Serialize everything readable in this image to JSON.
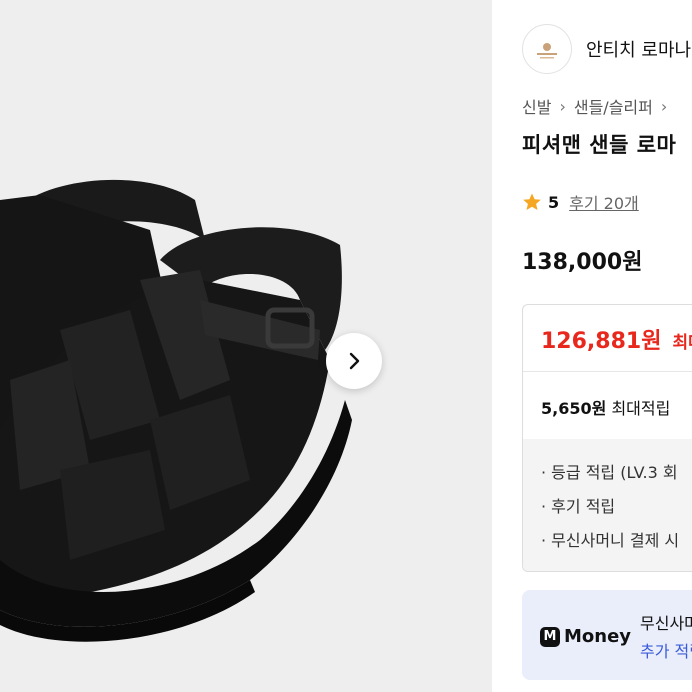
{
  "gallery": {
    "next_icon": "chevron-right-icon"
  },
  "brand": {
    "name": "안티치 로마나",
    "logo_icon": "brand-logo-icon"
  },
  "breadcrumb": [
    "신발",
    "샌들/슬리퍼"
  ],
  "product": {
    "title": "피셔맨 샌들 로마",
    "rating": "5",
    "reviews": "후기 20개",
    "price": "138,000원"
  },
  "benefit_box": {
    "sale_price": "126,881원",
    "sale_tag": "최대",
    "points_amount": "5,650원",
    "points_label": "최대적립",
    "benefits": [
      "· 등급 적립 (LV.3 회",
      "· 후기 적립",
      "· 무신사머니 결제 시"
    ]
  },
  "money_banner": {
    "logo_label": "Money",
    "text1": "무신사머니",
    "text2": "추가 적립"
  },
  "colors": {
    "sale_red": "#e8281d",
    "star": "#f5a623",
    "money_blue": "#3a5bd9",
    "money_bg": "#eaeefb"
  }
}
